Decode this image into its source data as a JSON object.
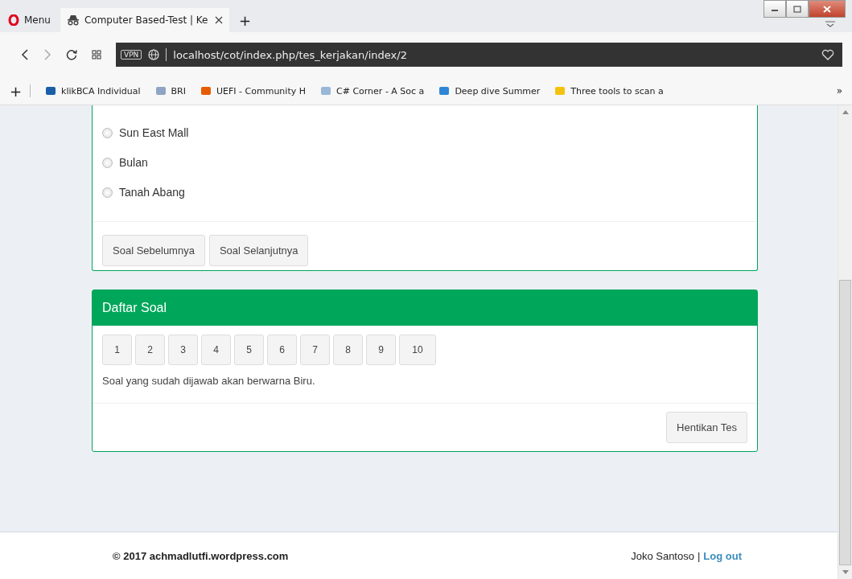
{
  "browser": {
    "menu_label": "Menu",
    "tabs": [
      {
        "title": "Computer Based-Test | Ke",
        "selected": true
      }
    ],
    "new_tab": "+",
    "address": "localhost/cot/index.php/tes_kerjakan/index/2",
    "vpn": "VPN",
    "add_bookmark": "+",
    "bookmarks": [
      {
        "label": "klikBCA Individual"
      },
      {
        "label": "BRI"
      },
      {
        "label": "UEFI - Community H"
      },
      {
        "label": "C# Corner - A Soc a"
      },
      {
        "label": "Deep dive Summer"
      },
      {
        "label": "Three tools to scan a"
      }
    ],
    "more": "»"
  },
  "question": {
    "options": [
      {
        "label": "Sun East Mall",
        "selected": false
      },
      {
        "label": "Bulan",
        "selected": false
      },
      {
        "label": "Tanah Abang",
        "selected": false
      }
    ],
    "buttons": [
      "Soal Sebelumnya",
      "Soal Selanjutnya"
    ]
  },
  "question_list": {
    "title": "Daftar Soal",
    "numbers": [
      {
        "label": "1",
        "answered": false
      },
      {
        "label": "2",
        "answered": false
      },
      {
        "label": "3",
        "answered": false
      },
      {
        "label": "4",
        "answered": false
      },
      {
        "label": "5",
        "answered": false
      },
      {
        "label": "6",
        "answered": false
      },
      {
        "label": "7",
        "answered": false
      },
      {
        "label": "8",
        "answered": false
      },
      {
        "label": "9",
        "answered": false
      },
      {
        "label": "10",
        "answered": false
      }
    ],
    "note": "Soal yang sudah dijawab akan berwarna Biru.",
    "stop_button": "Hentikan Tes"
  },
  "footer": {
    "copyright": "© 2017 achmadlutfi.wordpress.com",
    "user": "Joko Santoso",
    "separator": "|",
    "logout": "Log out"
  }
}
